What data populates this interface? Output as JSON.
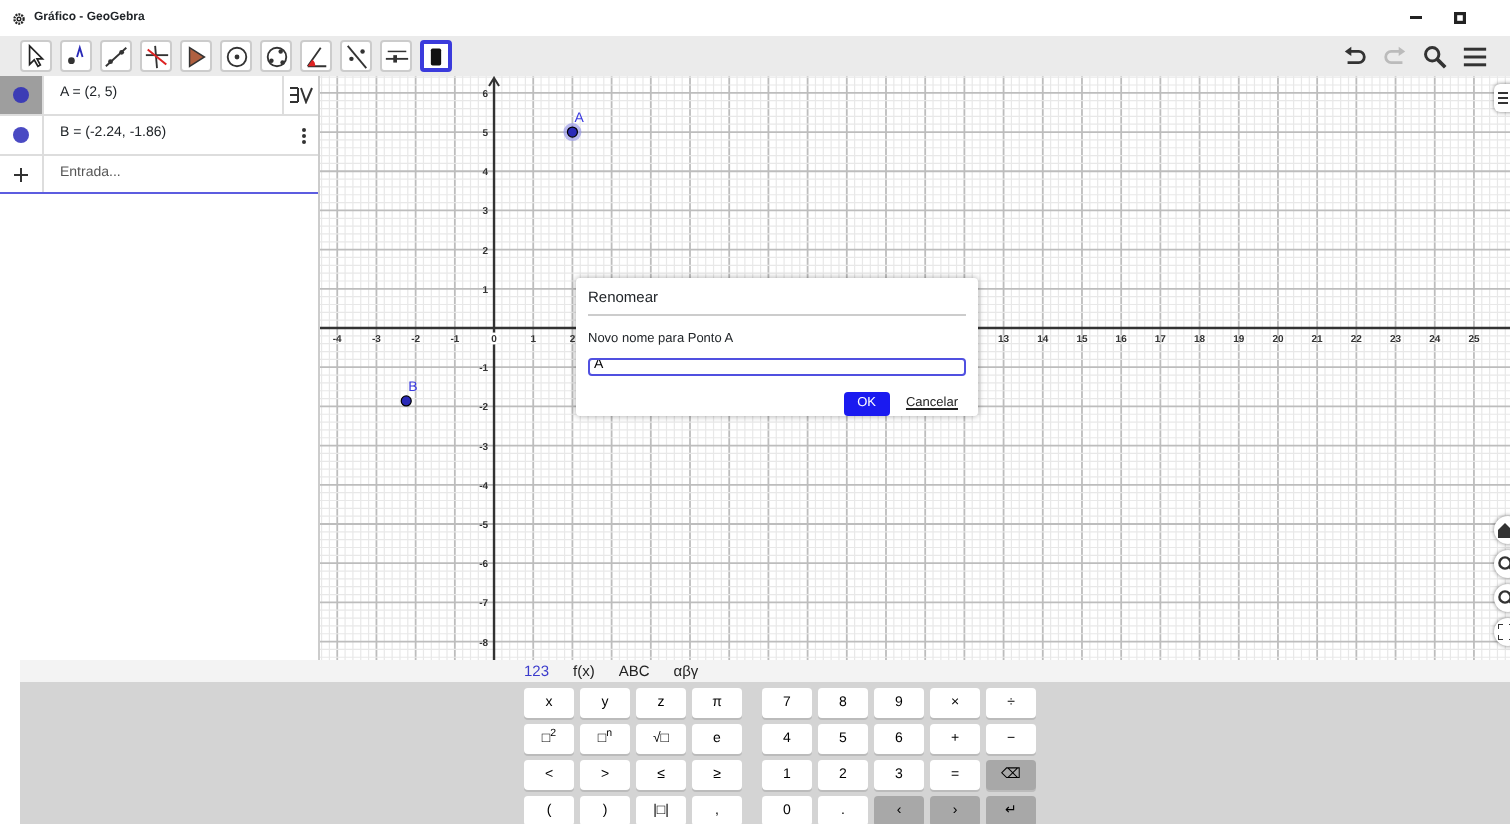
{
  "window": {
    "title": "Gráfico - GeoGebra"
  },
  "toolbar": {
    "tools": [
      {
        "kind": "move",
        "selected": false
      },
      {
        "kind": "point",
        "selected": false
      },
      {
        "kind": "line",
        "selected": false
      },
      {
        "kind": "perpendicular",
        "selected": false
      },
      {
        "kind": "polygon",
        "selected": false
      },
      {
        "kind": "circle",
        "selected": false
      },
      {
        "kind": "circle3",
        "selected": false
      },
      {
        "kind": "angle",
        "selected": false
      },
      {
        "kind": "reflect",
        "selected": false
      },
      {
        "kind": "slider",
        "selected": false
      },
      {
        "kind": "delete",
        "selected": true
      }
    ],
    "actions": [
      {
        "kind": "undo",
        "disabled": false
      },
      {
        "kind": "redo",
        "disabled": true
      },
      {
        "kind": "search",
        "disabled": false
      },
      {
        "kind": "menu",
        "disabled": false
      }
    ]
  },
  "algebra": {
    "rows": [
      {
        "text": "A = (2, 5)",
        "selected": true
      },
      {
        "text": "B = (-2.24, -1.86)",
        "selected": false
      }
    ],
    "input": {
      "placeholder": "Entrada..."
    }
  },
  "graphics": {
    "points": [
      {
        "label": "A",
        "selected": true
      },
      {
        "label": "B",
        "selected": false
      }
    ],
    "chart_data": {
      "type": "scatter",
      "x": [
        2,
        -2.24
      ],
      "series": [
        {
          "color": "#2a2ab8",
          "values": [
            5,
            -1.86
          ]
        }
      ],
      "grid": true,
      "xlim": [
        -4.44,
        25.92
      ],
      "ylim": [
        -8.47,
        6.43
      ],
      "xticks": [
        -4,
        -3,
        -2,
        -1,
        0,
        1,
        2,
        13,
        14,
        15,
        16,
        17,
        18,
        19,
        20,
        21,
        22,
        23,
        24,
        25
      ],
      "yticks": [
        -8,
        -7,
        -6,
        -5,
        -4,
        -3,
        -2,
        -1,
        1,
        2,
        3,
        4,
        5,
        6
      ]
    }
  },
  "dialog": {
    "title": "Renomear",
    "label": "Novo nome para Ponto A",
    "value": "A",
    "ok": "OK",
    "cancel": "Cancelar"
  },
  "keyboard": {
    "tabs": [
      {
        "label": "123",
        "selected": true
      },
      {
        "label": "f(x)",
        "selected": false
      },
      {
        "label": "ABC",
        "selected": false
      },
      {
        "label": "αβγ",
        "selected": false
      }
    ],
    "left_keys": [
      {
        "label": "x",
        "kind": "char"
      },
      {
        "label": "y",
        "kind": "char"
      },
      {
        "label": "z",
        "kind": "char"
      },
      {
        "label": "π",
        "kind": "char"
      },
      {
        "label": "□$^{2}$",
        "kind": "char"
      },
      {
        "label": "□$^{n}$",
        "kind": "char"
      },
      {
        "label": "√□",
        "kind": "char"
      },
      {
        "label": "e",
        "kind": "char"
      },
      {
        "label": "<",
        "kind": "char"
      },
      {
        "label": ">",
        "kind": "char"
      },
      {
        "label": "≤",
        "kind": "char"
      },
      {
        "label": "≥",
        "kind": "char"
      },
      {
        "label": "(",
        "kind": "char"
      },
      {
        "label": ")",
        "kind": "char"
      },
      {
        "label": "|□|",
        "kind": "char"
      },
      {
        "label": ",",
        "kind": "char"
      }
    ],
    "right_keys": [
      {
        "label": "7",
        "kind": "char"
      },
      {
        "label": "8",
        "kind": "char"
      },
      {
        "label": "9",
        "kind": "char"
      },
      {
        "label": "×",
        "kind": "char"
      },
      {
        "label": "÷",
        "kind": "char"
      },
      {
        "label": "4",
        "kind": "char"
      },
      {
        "label": "5",
        "kind": "char"
      },
      {
        "label": "6",
        "kind": "char"
      },
      {
        "label": "+",
        "kind": "char"
      },
      {
        "label": "−",
        "kind": "char"
      },
      {
        "label": "1",
        "kind": "char"
      },
      {
        "label": "2",
        "kind": "char"
      },
      {
        "label": "3",
        "kind": "char"
      },
      {
        "label": "=",
        "kind": "char"
      },
      {
        "label": "⌫",
        "kind": "action"
      },
      {
        "label": "0",
        "kind": "char"
      },
      {
        "label": ".",
        "kind": "char"
      },
      {
        "label": "‹",
        "kind": "action"
      },
      {
        "label": "›",
        "kind": "action"
      },
      {
        "label": "↵",
        "kind": "action"
      }
    ]
  }
}
